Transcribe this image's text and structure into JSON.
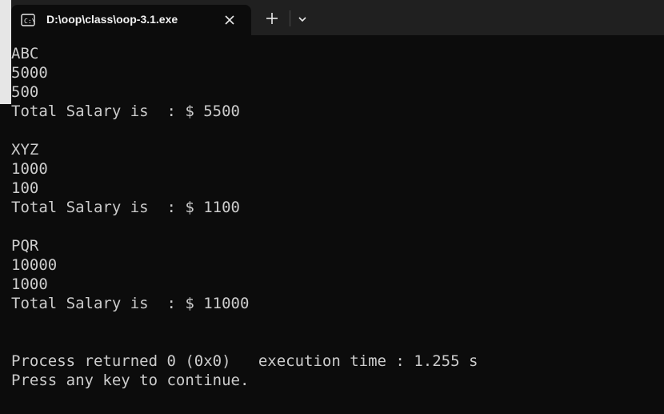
{
  "tab": {
    "icon": "console-icon",
    "title": "D:\\oop\\class\\oop-3.1.exe"
  },
  "controls": {
    "close_icon": "close-icon",
    "new_tab_icon": "plus-icon",
    "dropdown_icon": "chevron-down-icon"
  },
  "console": {
    "lines": [
      "ABC",
      "5000",
      "500",
      "Total Salary is  : $ 5500",
      "",
      "XYZ",
      "1000",
      "100",
      "Total Salary is  : $ 1100",
      "",
      "PQR",
      "10000",
      "1000",
      "Total Salary is  : $ 11000",
      "",
      "",
      "Process returned 0 (0x0)   execution time : 1.255 s",
      "Press any key to continue."
    ]
  },
  "colors": {
    "background": "#0c0c0c",
    "tabbar": "#202020",
    "text": "#cccccc"
  }
}
